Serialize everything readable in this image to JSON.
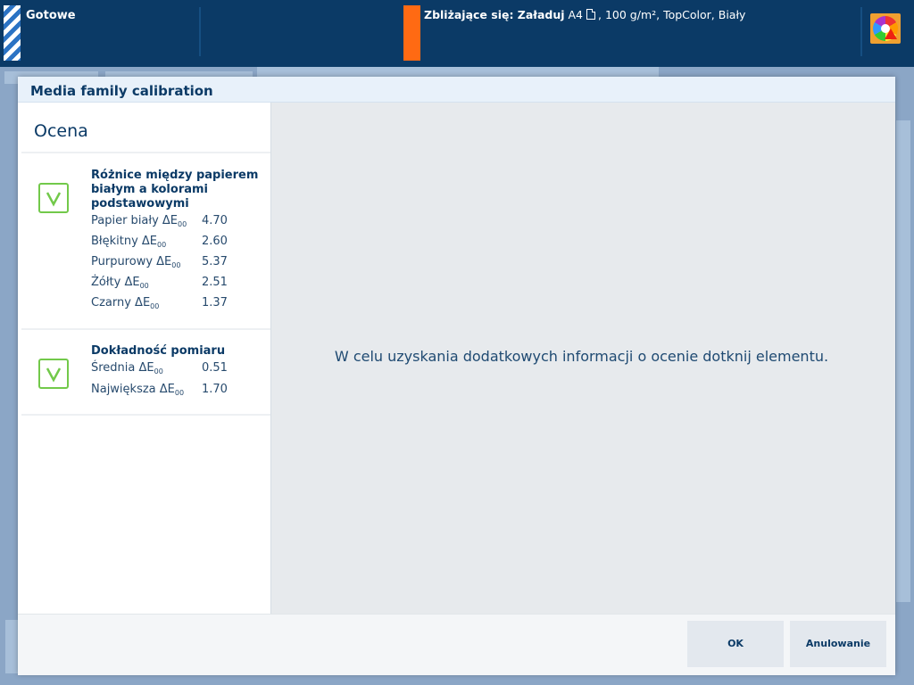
{
  "statusbar": {
    "status": "Gotowe",
    "upcoming_label": "Zbliżające się: Załaduj",
    "upcoming_size": "A4",
    "upcoming_details": ", 100 g/m², TopColor, Biały"
  },
  "icons": {
    "status": "striped-status-icon",
    "upcoming": "orange-tray-indicator",
    "document": "document-icon",
    "color_warning": "color-wheel-warning-icon",
    "check": "check-icon"
  },
  "colors": {
    "accent": "#0b3a66",
    "warning": "#ff6a13",
    "success": "#72c94a"
  },
  "dialog": {
    "title": "Media family calibration",
    "panel_title": "Ocena",
    "sections": [
      {
        "title": "Różnice między papierem białym a kolorami podstawowymi",
        "metrics": [
          {
            "label": "Papier biały ΔE",
            "sub": "00",
            "value": "4.70"
          },
          {
            "label": "Błękitny ΔE",
            "sub": "00",
            "value": "2.60"
          },
          {
            "label": "Purpurowy ΔE",
            "sub": "00",
            "value": "5.37"
          },
          {
            "label": "Żółty ΔE",
            "sub": "00",
            "value": "2.51"
          },
          {
            "label": "Czarny ΔE",
            "sub": "00",
            "value": "1.37"
          }
        ]
      },
      {
        "title": "Dokładność pomiaru",
        "metrics": [
          {
            "label": "Średnia ΔE",
            "sub": "00",
            "value": "0.51"
          },
          {
            "label": "Największa ΔE",
            "sub": "00",
            "value": "1.70"
          }
        ]
      }
    ],
    "hint": "W celu uzyskania dodatkowych informacji o ocenie dotknij elementu.",
    "ok_label": "OK",
    "cancel_label": "Anulowanie"
  }
}
